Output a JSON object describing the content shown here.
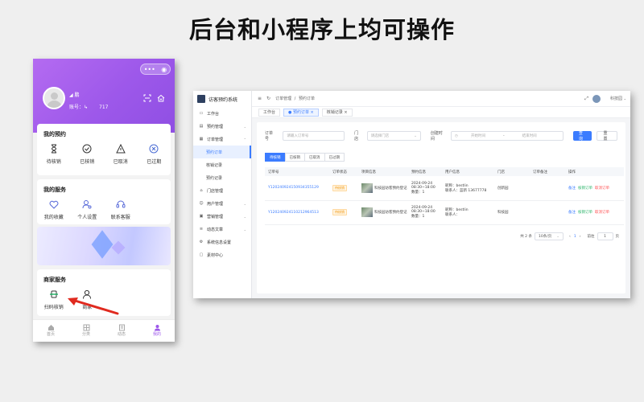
{
  "page_title": "后台和小程序上均可操作",
  "mobile": {
    "user": {
      "nickname": "◢ 鹏",
      "account_label": "账号：",
      "account_prefix": "↳",
      "account_value": "717"
    },
    "capsule": {
      "more": "•••",
      "close": "◉"
    },
    "header_icons": [
      "scan-icon",
      "home-icon"
    ],
    "my_booking": {
      "title": "我的预约",
      "items": [
        {
          "label": "待核销",
          "icon": "hourglass-icon"
        },
        {
          "label": "已核销",
          "icon": "check-circle-icon"
        },
        {
          "label": "已取消",
          "icon": "warning-triangle-icon"
        },
        {
          "label": "已过期",
          "icon": "x-circle-icon"
        }
      ]
    },
    "my_service": {
      "title": "我的服务",
      "items": [
        {
          "label": "我的收藏",
          "icon": "heart-icon"
        },
        {
          "label": "个人设置",
          "icon": "user-settings-icon"
        },
        {
          "label": "联系客服",
          "icon": "headset-icon"
        }
      ]
    },
    "merchant_service": {
      "title": "商家服务",
      "items": [
        {
          "label": "扫码核销",
          "icon": "scan-code-icon"
        },
        {
          "label": "商家",
          "icon": "merchant-user-icon"
        }
      ]
    },
    "tabbar": [
      {
        "label": "首页",
        "icon": "home-icon"
      },
      {
        "label": "分类",
        "icon": "grid-icon"
      },
      {
        "label": "动态",
        "icon": "news-icon"
      },
      {
        "label": "我的",
        "icon": "person-icon",
        "active": true
      }
    ],
    "accent_color": "#9d58ea"
  },
  "admin": {
    "brand": "访客预约系统",
    "breadcrumb": [
      "订单管理",
      "预约订单"
    ],
    "user_name": "科技园",
    "sidebar": [
      {
        "label": "工作台",
        "icon": "desktop-icon"
      },
      {
        "label": "预约管理",
        "icon": "calendar-icon",
        "arrow": "⌄"
      },
      {
        "label": "订单管理",
        "icon": "order-icon",
        "arrow": "⌃"
      },
      {
        "label": "预约订单",
        "sub": true,
        "active": true
      },
      {
        "label": "核销记录",
        "sub": true
      },
      {
        "label": "预约记录",
        "sub": true
      },
      {
        "label": "门店管理",
        "icon": "store-icon"
      },
      {
        "label": "用户管理",
        "icon": "users-icon",
        "arrow": "⌄"
      },
      {
        "label": "营销管理",
        "icon": "marketing-icon",
        "arrow": "⌄"
      },
      {
        "label": "动态文章",
        "icon": "article-icon",
        "arrow": "⌄"
      },
      {
        "label": "系统信息设置",
        "icon": "settings-icon"
      },
      {
        "label": "素材中心",
        "icon": "media-icon"
      }
    ],
    "tabs": [
      {
        "label": "工作台",
        "active": false
      },
      {
        "label": "● 预约订单 ×",
        "active": true
      },
      {
        "label": "核销记录 ×",
        "active": false
      }
    ],
    "filters": {
      "order_no_label": "订单号",
      "order_no_placeholder": "请输入订单号",
      "store_label": "门店",
      "store_placeholder": "请选择门店",
      "created_label": "创建时间",
      "start_placeholder": "开始时间",
      "range_sep": "-",
      "end_placeholder": "结束时间",
      "query_button": "查询",
      "reset_button": "重置"
    },
    "status_tabs": [
      {
        "label": "待核销",
        "active": true
      },
      {
        "label": "已核销",
        "active": false
      },
      {
        "label": "已取消",
        "active": false
      },
      {
        "label": "已过期",
        "active": false
      }
    ],
    "table": {
      "columns": [
        "订单号",
        "订单状态",
        "项目信息",
        "预约信息",
        "用户信息",
        "门店",
        "订单备注",
        "操作"
      ],
      "rows": [
        {
          "order_no": "Y120240924150934355129",
          "status": "待核销",
          "project": "科技园访客预约登记",
          "date": "2024-09-24",
          "time": "08:30~18:00",
          "qty": "数量：1",
          "nickname": "昵称：bestlin",
          "contact": "联系人：蓝新 13677778",
          "store": "创新园",
          "remark": "",
          "actions": [
            "备注",
            "核销订单",
            "取消订单"
          ]
        },
        {
          "order_no": "Y120240924110212964513",
          "status": "待核销",
          "project": "科技园访客预约登记",
          "date": "2024-09-24",
          "time": "08:30~18:00",
          "qty": "数量：1",
          "nickname": "昵称：bestlin",
          "contact": "联系人：",
          "store": "科技园",
          "remark": "",
          "actions": [
            "备注",
            "核销订单",
            "取消订单"
          ]
        }
      ]
    },
    "pagination": {
      "total": "共 2 条",
      "page_size": "10条/页",
      "prev": "‹",
      "current": "1",
      "next": "›",
      "goto_label": "前往",
      "goto_value": "1",
      "page_unit": "页"
    },
    "primary_color": "#3b7cff"
  }
}
